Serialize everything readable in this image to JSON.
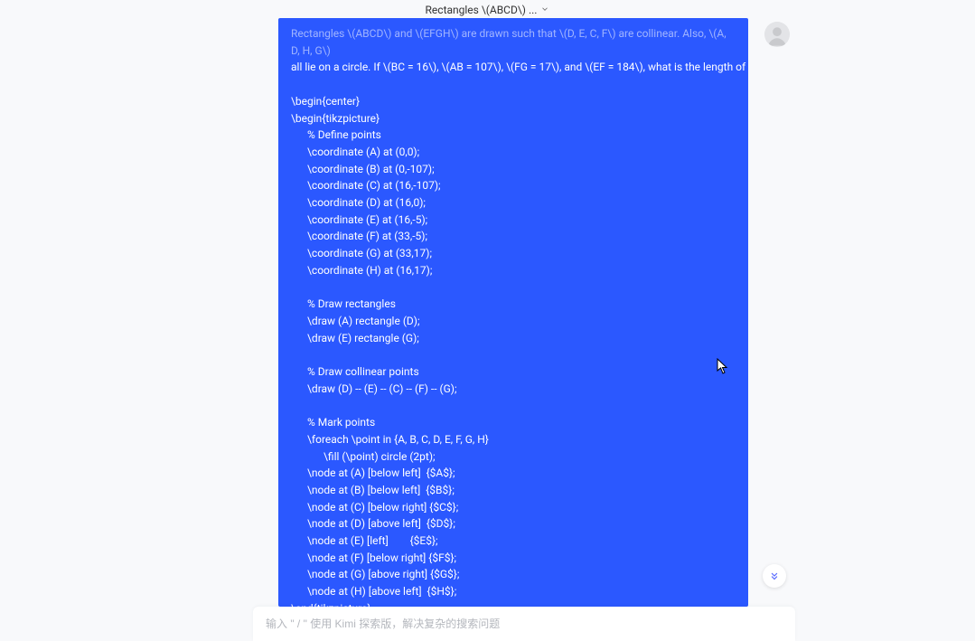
{
  "header": {
    "title": "Rectangles \\(ABCD\\) ..."
  },
  "message": {
    "intro_faded": "Rectangles \\(ABCD\\) and \\(EFGH\\) are drawn such that \\(D, E, C, F\\) are collinear. Also, \\(A, D, H, G\\)",
    "intro2": "all lie on a circle. If \\(BC = 16\\), \\(AB = 107\\), \\(FG = 17\\), and \\(EF = 184\\), what is the length of \\(CE\\)?",
    "lines": [
      {
        "t": "",
        "cls": "blank"
      },
      {
        "t": "\\begin{center}",
        "cls": ""
      },
      {
        "t": "\\begin{tikzpicture}",
        "cls": ""
      },
      {
        "t": "% Define points",
        "cls": "indent1"
      },
      {
        "t": "\\coordinate (A) at (0,0);",
        "cls": "indent1"
      },
      {
        "t": "\\coordinate (B) at (0,-107);",
        "cls": "indent1"
      },
      {
        "t": "\\coordinate (C) at (16,-107);",
        "cls": "indent1"
      },
      {
        "t": "\\coordinate (D) at (16,0);",
        "cls": "indent1"
      },
      {
        "t": "\\coordinate (E) at (16,-5);",
        "cls": "indent1"
      },
      {
        "t": "\\coordinate (F) at (33,-5);",
        "cls": "indent1"
      },
      {
        "t": "\\coordinate (G) at (33,17);",
        "cls": "indent1"
      },
      {
        "t": "\\coordinate (H) at (16,17);",
        "cls": "indent1"
      },
      {
        "t": "",
        "cls": "blank"
      },
      {
        "t": "% Draw rectangles",
        "cls": "indent1"
      },
      {
        "t": "\\draw (A) rectangle (D);",
        "cls": "indent1"
      },
      {
        "t": "\\draw (E) rectangle (G);",
        "cls": "indent1"
      },
      {
        "t": "",
        "cls": "blank"
      },
      {
        "t": "% Draw collinear points",
        "cls": "indent1"
      },
      {
        "t": "\\draw (D) -- (E) -- (C) -- (F) -- (G);",
        "cls": "indent1"
      },
      {
        "t": "",
        "cls": "blank"
      },
      {
        "t": "% Mark points",
        "cls": "indent1"
      },
      {
        "t": "\\foreach \\point in {A, B, C, D, E, F, G, H}",
        "cls": "indent1"
      },
      {
        "t": "\\fill (\\point) circle (2pt);",
        "cls": "indent2"
      },
      {
        "t": "\\node at (A) [below left]  {$A$};",
        "cls": "indent1"
      },
      {
        "t": "\\node at (B) [below left]  {$B$};",
        "cls": "indent1"
      },
      {
        "t": "\\node at (C) [below right] {$C$};",
        "cls": "indent1"
      },
      {
        "t": "\\node at (D) [above left]  {$D$};",
        "cls": "indent1"
      },
      {
        "t": "\\node at (E) [left]        {$E$};",
        "cls": "indent1"
      },
      {
        "t": "\\node at (F) [below right] {$F$};",
        "cls": "indent1"
      },
      {
        "t": "\\node at (G) [above right] {$G$};",
        "cls": "indent1"
      },
      {
        "t": "\\node at (H) [above left]  {$H$};",
        "cls": "indent1"
      },
      {
        "t": "\\end{tikzpicture}",
        "cls": ""
      }
    ]
  },
  "input": {
    "placeholder": "输入 \" / \" 使用 Kimi 探索版，解决复杂的搜索问题"
  }
}
